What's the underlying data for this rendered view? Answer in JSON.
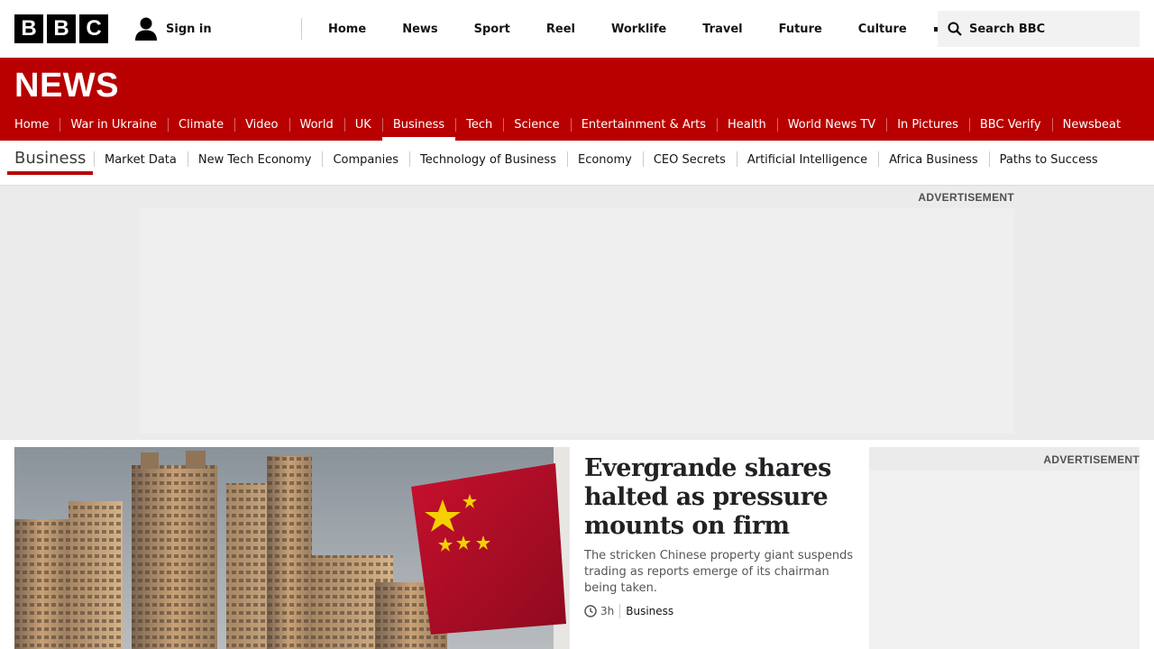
{
  "brand": {
    "letters": [
      "B",
      "B",
      "C"
    ]
  },
  "header": {
    "sign_in": "Sign in",
    "nav": [
      "Home",
      "News",
      "Sport",
      "Reel",
      "Worklife",
      "Travel",
      "Future",
      "Culture"
    ],
    "search_label": "Search BBC"
  },
  "news": {
    "logo": "NEWS",
    "nav": [
      {
        "label": "Home"
      },
      {
        "label": "War in Ukraine"
      },
      {
        "label": "Climate"
      },
      {
        "label": "Video"
      },
      {
        "label": "World"
      },
      {
        "label": "UK"
      },
      {
        "label": "Business",
        "active": true
      },
      {
        "label": "Tech"
      },
      {
        "label": "Science"
      },
      {
        "label": "Entertainment & Arts"
      },
      {
        "label": "Health"
      },
      {
        "label": "World News TV"
      },
      {
        "label": "In Pictures"
      },
      {
        "label": "BBC Verify"
      },
      {
        "label": "Newsbeat"
      }
    ]
  },
  "section": {
    "title": "Business",
    "items": [
      "Market Data",
      "New Tech Economy",
      "Companies",
      "Technology of Business",
      "Economy",
      "CEO Secrets",
      "Artificial Intelligence",
      "Africa Business",
      "Paths to Success"
    ]
  },
  "ads": {
    "top_label": "ADVERTISEMENT",
    "side_label": "ADVERTISEMENT"
  },
  "lead": {
    "headline": "Evergrande shares halted as pressure mounts on firm",
    "summary": "The stricken Chinese property giant suspends trading as reports emerge of its chairman being taken.",
    "time": "3h",
    "section": "Business",
    "image_alt": "Apartment towers with a Chinese flag"
  },
  "colors": {
    "brand_red": "#b80000",
    "flag_red": "#c8102e",
    "flag_star": "#f4d000"
  },
  "icons": {
    "user": "user-icon",
    "search": "search-icon",
    "clock": "clock-icon",
    "more": "more-icon"
  }
}
